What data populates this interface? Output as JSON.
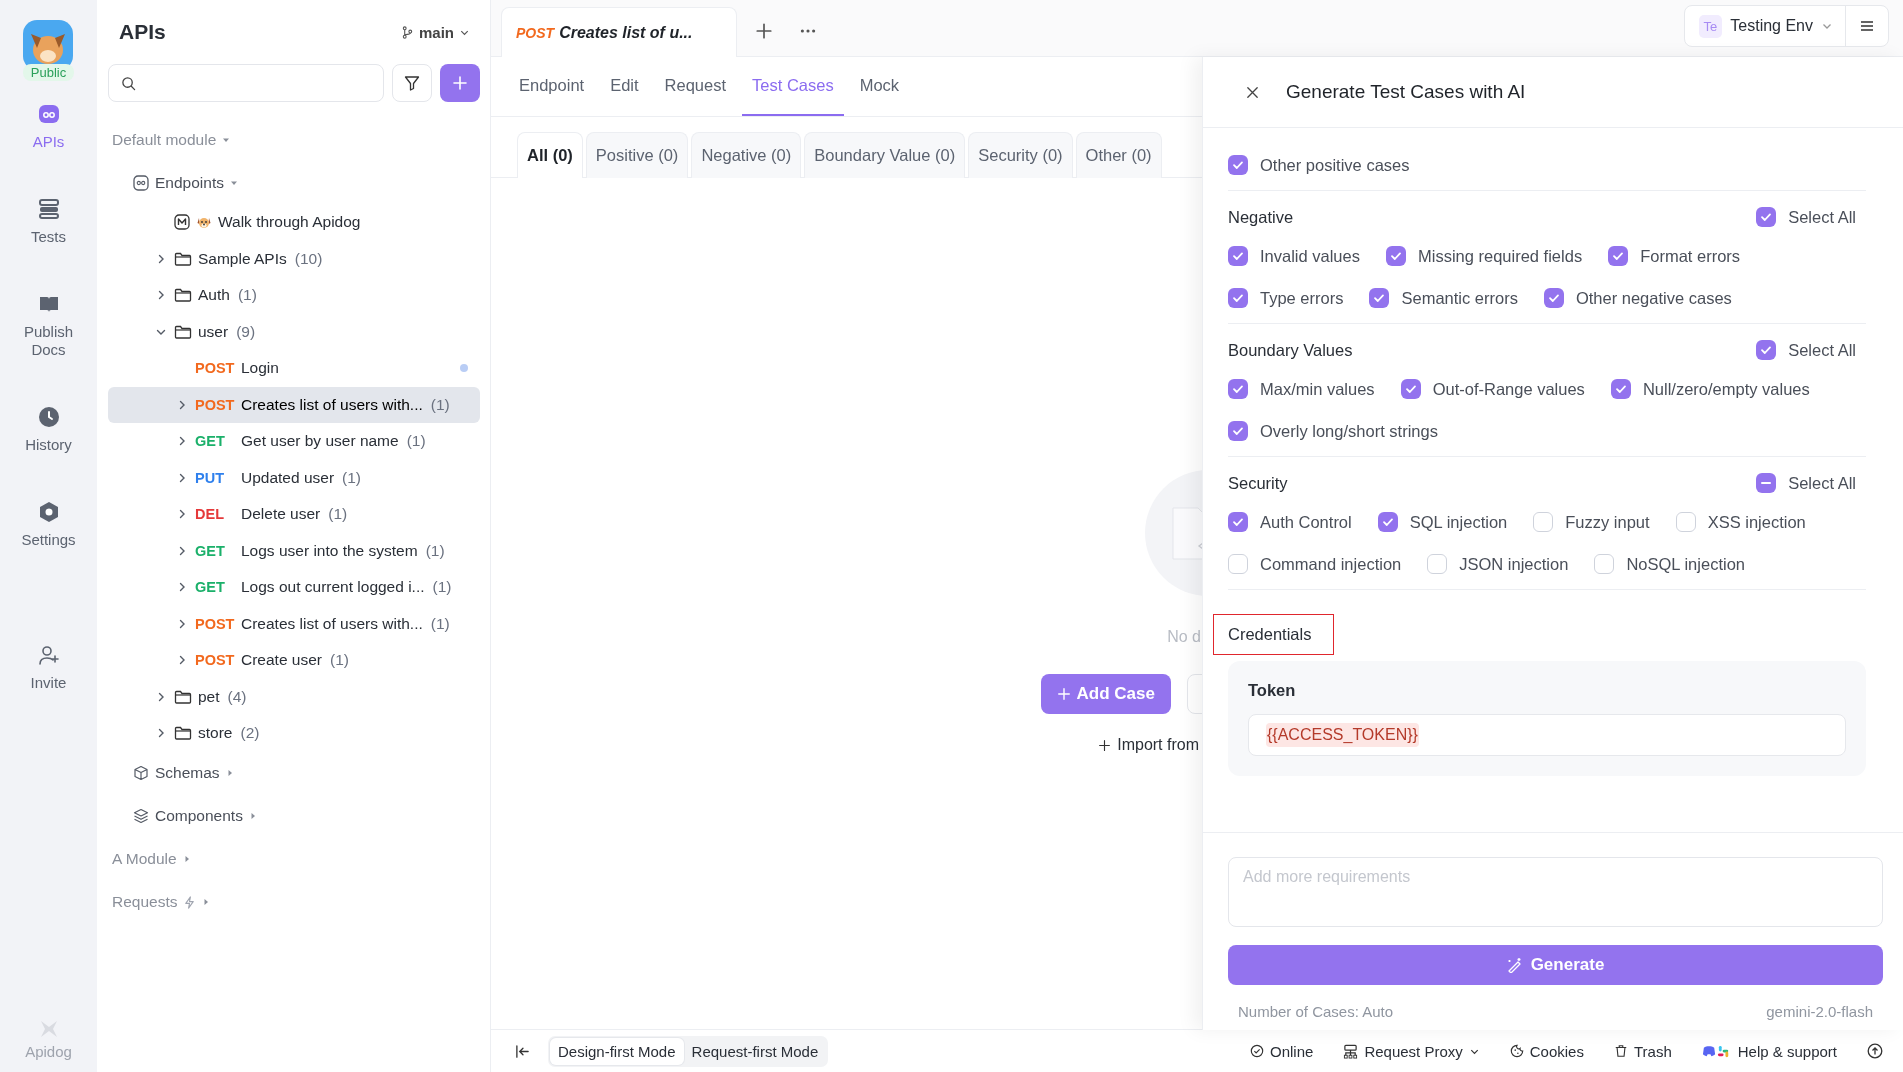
{
  "rail": {
    "badge": "Public",
    "items": [
      {
        "kind": "apis",
        "label": "APIs",
        "selected": true
      },
      {
        "kind": "tests",
        "label": "Tests",
        "selected": false
      },
      {
        "kind": "docs",
        "label": "Publish Docs",
        "selected": false
      },
      {
        "kind": "history",
        "label": "History",
        "selected": false
      },
      {
        "kind": "settings",
        "label": "Settings",
        "selected": false
      }
    ],
    "invite": "Invite",
    "brand": "Apidog"
  },
  "sidebar": {
    "title": "APIs",
    "branch": "main",
    "tree": [
      {
        "kind": "module",
        "label": "Default module",
        "expanded": true,
        "children": [
          {
            "kind": "endpoints",
            "label": "Endpoints",
            "expanded": true,
            "children": [
              {
                "kind": "doc",
                "label": "Walk through Apidog"
              },
              {
                "kind": "folder",
                "label": "Sample APIs",
                "count": "(10)",
                "expanded": false
              },
              {
                "kind": "folder",
                "label": "Auth",
                "count": "(1)",
                "expanded": false
              },
              {
                "kind": "folder",
                "label": "user",
                "count": "(9)",
                "expanded": true,
                "children": [
                  {
                    "kind": "endpoint",
                    "method": "POST",
                    "label": "Login",
                    "expandable": false,
                    "selected": false,
                    "modified": true
                  },
                  {
                    "kind": "endpoint",
                    "method": "POST",
                    "label": "Creates list of users with...",
                    "count": "(1)",
                    "expandable": true,
                    "selected": true,
                    "modified": false
                  },
                  {
                    "kind": "endpoint",
                    "method": "GET",
                    "label": "Get user by user name",
                    "count": "(1)",
                    "expandable": true,
                    "selected": false,
                    "modified": false
                  },
                  {
                    "kind": "endpoint",
                    "method": "PUT",
                    "label": "Updated user",
                    "count": "(1)",
                    "expandable": true,
                    "selected": false,
                    "modified": false
                  },
                  {
                    "kind": "endpoint",
                    "method": "DEL",
                    "label": "Delete user",
                    "count": "(1)",
                    "expandable": true,
                    "selected": false,
                    "modified": false
                  },
                  {
                    "kind": "endpoint",
                    "method": "GET",
                    "label": "Logs user into the system",
                    "count": "(1)",
                    "expandable": true,
                    "selected": false,
                    "modified": false
                  },
                  {
                    "kind": "endpoint",
                    "method": "GET",
                    "label": "Logs out current logged i...",
                    "count": "(1)",
                    "expandable": true,
                    "selected": false,
                    "modified": false
                  },
                  {
                    "kind": "endpoint",
                    "method": "POST",
                    "label": "Creates list of users with...",
                    "count": "(1)",
                    "expandable": true,
                    "selected": false,
                    "modified": false
                  },
                  {
                    "kind": "endpoint",
                    "method": "POST",
                    "label": "Create user",
                    "count": "(1)",
                    "expandable": true,
                    "selected": false,
                    "modified": false
                  }
                ]
              },
              {
                "kind": "folder",
                "label": "pet",
                "count": "(4)",
                "expanded": false
              },
              {
                "kind": "folder",
                "label": "store",
                "count": "(2)",
                "expanded": false
              }
            ]
          },
          {
            "kind": "schemas",
            "label": "Schemas",
            "expanded": false
          },
          {
            "kind": "components",
            "label": "Components",
            "expanded": false
          }
        ]
      },
      {
        "kind": "module",
        "label": "A Module",
        "expanded": false
      },
      {
        "kind": "request-module",
        "label": "Requests",
        "expanded": false
      }
    ]
  },
  "editor_tab": {
    "method": "POST",
    "title": "Creates list of u..."
  },
  "environment": {
    "badge": "Te",
    "name": "Testing Env"
  },
  "tabs": [
    {
      "label": "Endpoint",
      "selected": false
    },
    {
      "label": "Edit",
      "selected": false
    },
    {
      "label": "Request",
      "selected": false
    },
    {
      "label": "Test Cases",
      "selected": true
    },
    {
      "label": "Mock",
      "selected": false
    }
  ],
  "case_filters": [
    {
      "label": "All (0)",
      "selected": true
    },
    {
      "label": "Positive (0)",
      "selected": false
    },
    {
      "label": "Negative (0)",
      "selected": false
    },
    {
      "label": "Boundary Value (0)",
      "selected": false
    },
    {
      "label": "Security (0)",
      "selected": false
    },
    {
      "label": "Other (0)",
      "selected": false
    }
  ],
  "empty_state": {
    "message": "No d",
    "add_button": "Add Case",
    "import_link": "Import from"
  },
  "panel": {
    "title": "Generate Test Cases with AI",
    "sections": [
      {
        "rows": [
          [
            {
              "label": "Other positive cases",
              "checked": true
            }
          ]
        ]
      },
      {
        "title": "Negative",
        "select_all": {
          "label": "Select All",
          "checked": true,
          "partial": false
        },
        "rows": [
          [
            {
              "label": "Invalid values",
              "checked": true
            },
            {
              "label": "Missing required fields",
              "checked": true
            },
            {
              "label": "Format errors",
              "checked": true
            }
          ],
          [
            {
              "label": "Type errors",
              "checked": true
            },
            {
              "label": "Semantic errors",
              "checked": true
            },
            {
              "label": "Other negative cases",
              "checked": true
            }
          ]
        ]
      },
      {
        "title": "Boundary Values",
        "select_all": {
          "label": "Select All",
          "checked": true,
          "partial": false
        },
        "rows": [
          [
            {
              "label": "Max/min values",
              "checked": true
            },
            {
              "label": "Out-of-Range values",
              "checked": true
            },
            {
              "label": "Null/zero/empty values",
              "checked": true
            }
          ],
          [
            {
              "label": "Overly long/short strings",
              "checked": true
            }
          ]
        ]
      },
      {
        "title": "Security",
        "select_all": {
          "label": "Select All",
          "checked": false,
          "partial": true
        },
        "rows": [
          [
            {
              "label": "Auth Control",
              "checked": true
            },
            {
              "label": "SQL injection",
              "checked": true
            },
            {
              "label": "Fuzzy input",
              "checked": false
            },
            {
              "label": "XSS injection",
              "checked": false
            }
          ],
          [
            {
              "label": "Command injection",
              "checked": false
            },
            {
              "label": "JSON injection",
              "checked": false
            },
            {
              "label": "NoSQL injection",
              "checked": false
            }
          ]
        ]
      }
    ],
    "credentials": {
      "title": "Credentials",
      "highlighted": true,
      "field_label": "Token",
      "value": "{{ACCESS_TOKEN}}"
    },
    "requirements": {
      "placeholder": "Add more requirements"
    },
    "generate_button": "Generate",
    "case_count": "Number of Cases: Auto",
    "model": "gemini-2.0-flash"
  },
  "status_bar": {
    "modes": [
      {
        "label": "Design-first Mode",
        "selected": true
      },
      {
        "label": "Request-first Mode",
        "selected": false
      }
    ],
    "items": [
      {
        "kind": "online",
        "label": "Online"
      },
      {
        "kind": "proxy",
        "label": "Request Proxy"
      },
      {
        "kind": "cookies",
        "label": "Cookies"
      },
      {
        "kind": "trash",
        "label": "Trash"
      },
      {
        "kind": "help",
        "label": "Help & support"
      }
    ]
  }
}
